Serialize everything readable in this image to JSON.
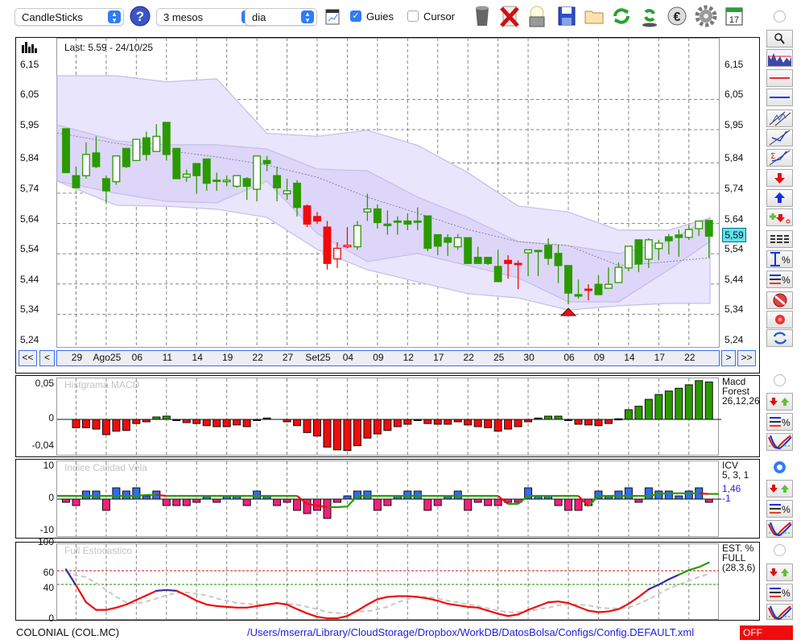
{
  "toolbar": {
    "chart_type": "CandleSticks",
    "period": "3 mesos",
    "interval": "dia",
    "guides_label": "Guies",
    "guides_checked": true,
    "cursor_label": "Cursor",
    "cursor_checked": false,
    "icons": [
      "help-icon",
      "chart-settings-icon",
      "trash-icon",
      "delete-icon",
      "lamp-icon",
      "save-icon",
      "folder-icon",
      "refresh-icon",
      "sync-icon",
      "euro-icon",
      "gear-icon",
      "calendar-icon"
    ],
    "calendar_day": "17"
  },
  "main": {
    "last_label": "Last: 5.59 - 24/10/25",
    "last_price_tag": "5,59",
    "price_labels": [
      {
        "text": "6,15",
        "v": 6.15
      },
      {
        "text": "6,05",
        "v": 6.05
      },
      {
        "text": "5,95",
        "v": 5.95
      },
      {
        "text": "5,84",
        "v": 5.84
      },
      {
        "text": "5,74",
        "v": 5.74
      },
      {
        "text": "5,64",
        "v": 5.64
      },
      {
        "text": "5,54",
        "v": 5.54
      },
      {
        "text": "5,44",
        "v": 5.44
      },
      {
        "text": "5,34",
        "v": 5.34
      },
      {
        "text": "5,24",
        "v": 5.24
      }
    ],
    "nav": {
      "first": "<<",
      "prev": "<",
      "next": ">",
      "last": ">>"
    },
    "dates": [
      {
        "label": "29",
        "idx": 1
      },
      {
        "label": "Ago25",
        "idx": 4
      },
      {
        "label": "06",
        "idx": 7
      },
      {
        "label": "11",
        "idx": 10
      },
      {
        "label": "14",
        "idx": 13
      },
      {
        "label": "19",
        "idx": 16
      },
      {
        "label": "22",
        "idx": 19
      },
      {
        "label": "27",
        "idx": 22
      },
      {
        "label": "Set25",
        "idx": 25
      },
      {
        "label": "04",
        "idx": 28
      },
      {
        "label": "09",
        "idx": 31
      },
      {
        "label": "12",
        "idx": 34
      },
      {
        "label": "17",
        "idx": 37
      },
      {
        "label": "22",
        "idx": 40
      },
      {
        "label": "25",
        "idx": 43
      },
      {
        "label": "30",
        "idx": 46
      },
      {
        "label": "06",
        "idx": 50
      },
      {
        "label": "09",
        "idx": 53
      },
      {
        "label": "14",
        "idx": 56
      },
      {
        "label": "17",
        "idx": 59
      },
      {
        "label": "22",
        "idx": 62
      }
    ]
  },
  "chart_data": [
    {
      "type": "candlestick",
      "title": "COLONIAL (COL.MC)",
      "ylim": [
        5.24,
        6.15
      ],
      "candles_ohlc_color": [
        [
          5.945,
          5.945,
          5.8,
          5.8,
          "g"
        ],
        [
          5.79,
          5.82,
          5.75,
          5.75,
          "g"
        ],
        [
          5.79,
          5.9,
          5.78,
          5.86,
          "g"
        ],
        [
          5.865,
          5.92,
          5.815,
          5.82,
          "g"
        ],
        [
          5.78,
          5.79,
          5.7,
          5.74,
          "g"
        ],
        [
          5.77,
          5.855,
          5.76,
          5.855,
          "g"
        ],
        [
          5.88,
          5.88,
          5.815,
          5.82,
          "g"
        ],
        [
          5.84,
          5.91,
          5.84,
          5.91,
          "g"
        ],
        [
          5.915,
          5.935,
          5.84,
          5.86,
          "g"
        ],
        [
          5.87,
          5.96,
          5.87,
          5.92,
          "g"
        ],
        [
          5.966,
          5.966,
          5.84,
          5.86,
          "g"
        ],
        [
          5.88,
          5.88,
          5.78,
          5.78,
          "g"
        ],
        [
          5.785,
          5.81,
          5.77,
          5.795,
          "g"
        ],
        [
          5.83,
          5.83,
          5.73,
          5.79,
          "g"
        ],
        [
          5.845,
          5.845,
          5.74,
          5.765,
          "g"
        ],
        [
          5.775,
          5.8,
          5.74,
          5.775,
          "g"
        ],
        [
          5.77,
          5.79,
          5.755,
          5.775,
          "g"
        ],
        [
          5.755,
          5.79,
          5.75,
          5.79,
          "g"
        ],
        [
          5.78,
          5.785,
          5.71,
          5.755,
          "g"
        ],
        [
          5.745,
          5.855,
          5.705,
          5.855,
          "g"
        ],
        [
          5.84,
          5.855,
          5.805,
          5.83,
          "g"
        ],
        [
          5.79,
          5.82,
          5.705,
          5.75,
          "g"
        ],
        [
          5.73,
          5.78,
          5.71,
          5.74,
          "g"
        ],
        [
          5.765,
          5.775,
          5.655,
          5.685,
          "g"
        ],
        [
          5.69,
          5.695,
          5.62,
          5.63,
          "r"
        ],
        [
          5.655,
          5.67,
          5.63,
          5.64,
          "r"
        ],
        [
          5.62,
          5.64,
          5.48,
          5.5,
          "r"
        ],
        [
          5.515,
          5.57,
          5.485,
          5.55,
          "r"
        ],
        [
          5.555,
          5.62,
          5.55,
          5.56,
          "r"
        ],
        [
          5.555,
          5.64,
          5.545,
          5.625,
          "g"
        ],
        [
          5.67,
          5.73,
          5.64,
          5.68,
          "g"
        ],
        [
          5.68,
          5.695,
          5.615,
          5.635,
          "g"
        ],
        [
          5.63,
          5.675,
          5.595,
          5.625,
          "g"
        ],
        [
          5.64,
          5.655,
          5.595,
          5.64,
          "g"
        ],
        [
          5.64,
          5.665,
          5.61,
          5.63,
          "g"
        ],
        [
          5.64,
          5.685,
          5.61,
          5.64,
          "g"
        ],
        [
          5.657,
          5.657,
          5.54,
          5.55,
          "g"
        ],
        [
          5.595,
          5.595,
          5.527,
          5.557,
          "g"
        ],
        [
          5.585,
          5.597,
          5.525,
          5.57,
          "g"
        ],
        [
          5.555,
          5.597,
          5.545,
          5.585,
          "g"
        ],
        [
          5.585,
          5.585,
          5.5,
          5.5,
          "g"
        ],
        [
          5.52,
          5.555,
          5.5,
          5.5,
          "g"
        ],
        [
          5.52,
          5.52,
          5.495,
          5.5,
          "g"
        ],
        [
          5.49,
          5.545,
          5.44,
          5.44,
          "g"
        ],
        [
          5.51,
          5.527,
          5.45,
          5.5,
          "r"
        ],
        [
          5.5,
          5.51,
          5.415,
          5.5,
          "r"
        ],
        [
          5.535,
          5.545,
          5.458,
          5.545,
          "g"
        ],
        [
          5.543,
          5.543,
          5.458,
          5.543,
          "g"
        ],
        [
          5.56,
          5.583,
          5.495,
          5.517,
          "g"
        ],
        [
          5.533,
          5.562,
          5.435,
          5.493,
          "g"
        ],
        [
          5.493,
          5.493,
          5.365,
          5.402,
          "g"
        ],
        [
          5.397,
          5.447,
          5.384,
          5.392,
          "g"
        ],
        [
          5.415,
          5.431,
          5.378,
          5.415,
          "r"
        ],
        [
          5.431,
          5.461,
          5.397,
          5.397,
          "g"
        ],
        [
          5.418,
          5.487,
          5.418,
          5.431,
          "g"
        ],
        [
          5.437,
          5.503,
          5.437,
          5.487,
          "g"
        ],
        [
          5.485,
          5.557,
          5.474,
          5.557,
          "g"
        ],
        [
          5.578,
          5.578,
          5.471,
          5.498,
          "g"
        ],
        [
          5.514,
          5.583,
          5.485,
          5.578,
          "g"
        ],
        [
          5.549,
          5.578,
          5.511,
          5.567,
          "g"
        ],
        [
          5.588,
          5.597,
          5.53,
          5.575,
          "g"
        ],
        [
          5.594,
          5.612,
          5.522,
          5.586,
          "g"
        ],
        [
          5.586,
          5.628,
          5.578,
          5.612,
          "g"
        ],
        [
          5.615,
          5.64,
          5.591,
          5.64,
          "g"
        ],
        [
          5.642,
          5.642,
          5.519,
          5.59,
          "g"
        ]
      ],
      "signal_marker": {
        "type": "sell-triangle",
        "idx": 50
      },
      "bands": {
        "idx": [
          0,
          5,
          10,
          15,
          20,
          25,
          30,
          35,
          40,
          45,
          50,
          55,
          60,
          64
        ],
        "outer_upper": [
          6.12,
          6.12,
          6.1,
          6.11,
          5.93,
          5.92,
          5.94,
          5.89,
          5.8,
          5.69,
          5.67,
          5.61,
          5.61,
          5.65
        ],
        "inner_upper": [
          5.958,
          5.905,
          5.892,
          5.892,
          5.878,
          5.812,
          5.806,
          5.719,
          5.652,
          5.572,
          5.559,
          5.533,
          5.572,
          5.652
        ],
        "middle": [
          5.931,
          5.897,
          5.873,
          5.852,
          5.825,
          5.785,
          5.719,
          5.666,
          5.612,
          5.572,
          5.559,
          5.493,
          5.506,
          5.519
        ],
        "inner_lower": [
          5.772,
          5.732,
          5.705,
          5.7,
          5.772,
          5.599,
          5.506,
          5.533,
          5.493,
          5.453,
          5.373,
          5.373,
          5.479,
          5.572
        ],
        "outer_lower": [
          5.772,
          5.692,
          5.689,
          5.679,
          5.652,
          5.546,
          5.479,
          5.439,
          5.4,
          5.386,
          5.346,
          5.36,
          5.368,
          5.368
        ]
      }
    },
    {
      "type": "bar",
      "title": "Histgrama MACD",
      "ylim": [
        -0.04,
        0.05
      ],
      "tick_labels": [
        {
          "text": "0,05",
          "v": 0.05
        },
        {
          "text": "0",
          "v": 0
        },
        {
          "text": "-0,04",
          "v": -0.04
        }
      ],
      "legend": [
        "Macd",
        "Forest",
        "26,12,26"
      ],
      "values": [
        null,
        -0.012,
        -0.012,
        -0.014,
        -0.022,
        -0.017,
        -0.016,
        -0.006,
        -0.0035,
        0.0035,
        0.0047,
        -0.001,
        -0.0047,
        -0.006,
        -0.009,
        -0.0105,
        -0.0105,
        -0.008,
        -0.0105,
        -0.001,
        0.002,
        0,
        -0.0035,
        -0.009,
        -0.019,
        -0.024,
        -0.04,
        -0.044,
        -0.045,
        -0.038,
        -0.027,
        -0.021,
        -0.016,
        -0.0105,
        -0.007,
        -0.001,
        -0.006,
        -0.007,
        -0.007,
        -0.0035,
        -0.008,
        -0.0105,
        -0.012,
        -0.017,
        -0.014,
        -0.0105,
        -0.0035,
        0.002,
        0.0047,
        0.0047,
        -0.001,
        -0.007,
        -0.008,
        -0.009,
        -0.006,
        0.001,
        0.014,
        0.019,
        0.029,
        0.036,
        0.041,
        0.045,
        0.05,
        0.056,
        0.054
      ]
    },
    {
      "type": "bar+line",
      "title": "Indice Calidad Vela",
      "ylim": [
        -10,
        10
      ],
      "tick_labels": [
        {
          "text": "10",
          "v": 10
        },
        {
          "text": "0",
          "v": 0
        },
        {
          "text": "-10",
          "v": -10
        }
      ],
      "legend": [
        "ICV",
        "5, 3, 1"
      ],
      "readout": [
        "1,46",
        "-1"
      ],
      "bars": [
        -1,
        -2,
        2.5,
        2.5,
        -3.5,
        3.5,
        2.5,
        3.5,
        1,
        2.5,
        -2,
        -2,
        -2,
        -1,
        1,
        -1,
        1,
        1,
        -2,
        2.5,
        1,
        -2,
        -1,
        -3.5,
        -4.5,
        -3.5,
        -6,
        -1,
        1,
        2.5,
        2.5,
        -3.5,
        -2,
        1,
        2.5,
        2.5,
        -3.5,
        -2,
        1,
        2.5,
        -3.5,
        -1,
        -2,
        -2,
        -1,
        -1,
        3.5,
        1,
        1,
        -2,
        -3.5,
        -3.5,
        -2,
        2.5,
        1,
        2.5,
        3.5,
        -1,
        3.5,
        2.5,
        2.5,
        1,
        2.5,
        3.5,
        -1
      ],
      "line": [
        1,
        1,
        1,
        1,
        1,
        1,
        1,
        1,
        1.3,
        1.3,
        1,
        1,
        1,
        1,
        1,
        1,
        1,
        1,
        1,
        1,
        1,
        1,
        1,
        1,
        -1.5,
        -2,
        -2.5,
        -2.5,
        -2.3,
        1,
        1,
        1,
        1,
        1,
        1,
        1,
        1,
        1,
        1,
        1,
        1,
        1,
        1,
        1,
        -1.5,
        -1.5,
        1,
        1,
        1,
        1,
        1,
        1,
        -2.2,
        1,
        1,
        1,
        1,
        1,
        1,
        1.6,
        1.8,
        1.8,
        1.8,
        1.8,
        1.6
      ]
    },
    {
      "type": "line",
      "title": "Full Estocastico",
      "ylim": [
        0,
        100
      ],
      "tick_labels": [
        {
          "text": "100",
          "v": 100
        },
        {
          "text": "60",
          "v": 60
        },
        {
          "text": "40",
          "v": 40
        },
        {
          "text": "0",
          "v": 0
        }
      ],
      "levels": [
        60,
        40
      ],
      "legend": [
        "EST. %",
        "FULL",
        "(28,3,6)"
      ],
      "k": [
        66,
        45,
        23,
        13,
        13,
        16,
        20,
        26,
        32,
        38,
        39,
        38,
        32,
        25,
        20,
        18,
        17,
        16,
        16,
        18,
        20,
        22,
        20,
        14,
        8.5,
        4,
        2,
        2,
        5,
        12,
        20,
        27,
        30,
        31,
        31,
        30,
        28,
        25,
        21,
        19,
        17,
        16,
        12,
        8,
        5,
        7,
        13,
        18,
        23,
        24,
        22,
        17,
        12,
        10,
        11,
        14,
        21,
        30,
        40,
        46,
        53,
        59,
        65,
        69,
        75
      ],
      "d": [
        63,
        58,
        56,
        48,
        39,
        30,
        23,
        21,
        24,
        28,
        32,
        35,
        36,
        34,
        32,
        28,
        25,
        22,
        21,
        20,
        20,
        21,
        21,
        20,
        17,
        14,
        10,
        9,
        8,
        11,
        11,
        14,
        17,
        23,
        27,
        30,
        30,
        28,
        25,
        23,
        20,
        18,
        15,
        12,
        10,
        10,
        11,
        14,
        16,
        19,
        20,
        20,
        19,
        16,
        15,
        15,
        16,
        21,
        27,
        34,
        41,
        46,
        51,
        56,
        60
      ]
    }
  ],
  "right_toolbar": [
    "zoom-icon",
    "volume-profile-icon",
    "red-line-icon",
    "blue-line-icon",
    "channel-icon",
    "trendline-icon",
    "sigma-trendline-icon",
    "sell-arrow-icon",
    "buy-arrow-icon",
    "add-signal-icon",
    "grid-lines-icon",
    "range-percent-icon",
    "level-percent-icon",
    "stop-icon",
    "record-icon",
    "swap-icon"
  ],
  "status": {
    "symbol": "COLONIAL (COL.MC)",
    "config_path": "/Users/mserra/Library/CloudStorage/Dropbox/WorkDB/DatosBolsa/Configs/Config.DEFAULT.xml",
    "state": "OFF"
  },
  "colors": {
    "green": "#2a9a00",
    "red": "#f00c0c",
    "blue_bar": "#2e6ef0",
    "pink_bar": "#f0207a",
    "band_outer": "#e9e5fc",
    "band_inner": "#ddd6f8",
    "accent": "#2f7cf6"
  }
}
